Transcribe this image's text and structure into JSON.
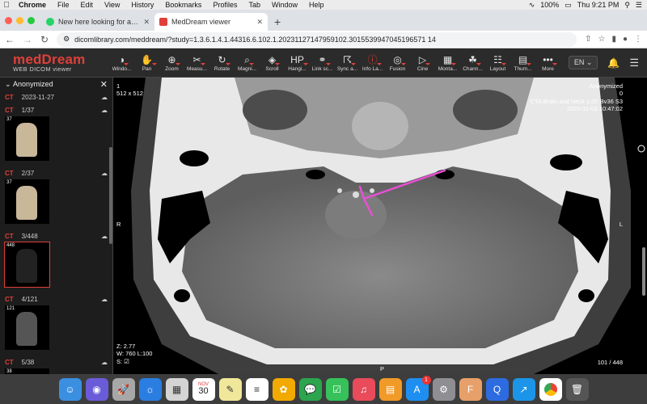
{
  "menubar": {
    "app_name": "Chrome",
    "items": [
      "File",
      "Edit",
      "View",
      "History",
      "Bookmarks",
      "Profiles",
      "Tab",
      "Window",
      "Help"
    ],
    "battery": "100%",
    "clock": "Thu 9:21 PM"
  },
  "tabs": [
    {
      "title": "New here looking for advice an",
      "favicon_color": "#25d366"
    },
    {
      "title": "MedDream viewer",
      "favicon_color": "#e0403a"
    }
  ],
  "address": {
    "url": "dicomlibrary.com/meddream/?study=1.3.6.1.4.1.44316.6.102.1.20231127147959102.3015539947045196571 14"
  },
  "app": {
    "brand": "medDream",
    "subtitle": "WEB DICOM viewer",
    "language": "EN"
  },
  "toolbar": {
    "tools": [
      {
        "label": "Windo...",
        "icon": "contrast-icon"
      },
      {
        "label": "Pan",
        "icon": "hand-icon"
      },
      {
        "label": "Zoom",
        "icon": "zoom-icon"
      },
      {
        "label": "Measu...",
        "icon": "ruler-icon"
      },
      {
        "label": "Rotate",
        "icon": "rotate-icon"
      },
      {
        "label": "Magni...",
        "icon": "magnify-icon"
      },
      {
        "label": "Scroll",
        "icon": "layers-icon"
      },
      {
        "label": "Hangi...",
        "icon": "hanging-protocol-icon"
      },
      {
        "label": "Link sc...",
        "icon": "link-icon"
      },
      {
        "label": "Sync a...",
        "icon": "sync-icon"
      },
      {
        "label": "Info La...",
        "icon": "info-icon"
      },
      {
        "label": "Fusion",
        "icon": "fusion-icon"
      },
      {
        "label": "Cine",
        "icon": "play-icon"
      },
      {
        "label": "Monta...",
        "icon": "montage-icon"
      },
      {
        "label": "Chann...",
        "icon": "channels-icon"
      },
      {
        "label": "Layout",
        "icon": "grid-icon"
      },
      {
        "label": "Thum...",
        "icon": "thumbnails-icon"
      },
      {
        "label": "More",
        "icon": "more-icon"
      }
    ]
  },
  "sidebar": {
    "patient": "Anonymized",
    "study_modality": "CT",
    "study_date": "2023-11-27",
    "series": [
      {
        "modality": "CT",
        "index": "1/37",
        "count": "37"
      },
      {
        "modality": "CT",
        "index": "2/37",
        "count": "37"
      },
      {
        "modality": "CT",
        "index": "3/448",
        "count": "448"
      },
      {
        "modality": "CT",
        "index": "4/121",
        "count": "121"
      },
      {
        "modality": "CT",
        "index": "5/38",
        "count": "38"
      }
    ]
  },
  "viewport": {
    "top_left": [
      "1",
      "512 x 512"
    ],
    "top_right": [
      "Anonymized",
      "0",
      "CTA Brain and Neck 1.00 Bv36 S3",
      "2023-11-03 10:47:02"
    ],
    "bottom_left": [
      "Z: 2.77",
      "W: 760 L:100",
      "S: ☑"
    ],
    "bottom_right": "101 / 448",
    "left_marker": "R",
    "right_marker": "L",
    "bottom_marker": "P",
    "annotation_color": "#e94fd6"
  },
  "dock": {
    "calendar_month": "NOV",
    "calendar_day": "30",
    "badge": "1"
  }
}
